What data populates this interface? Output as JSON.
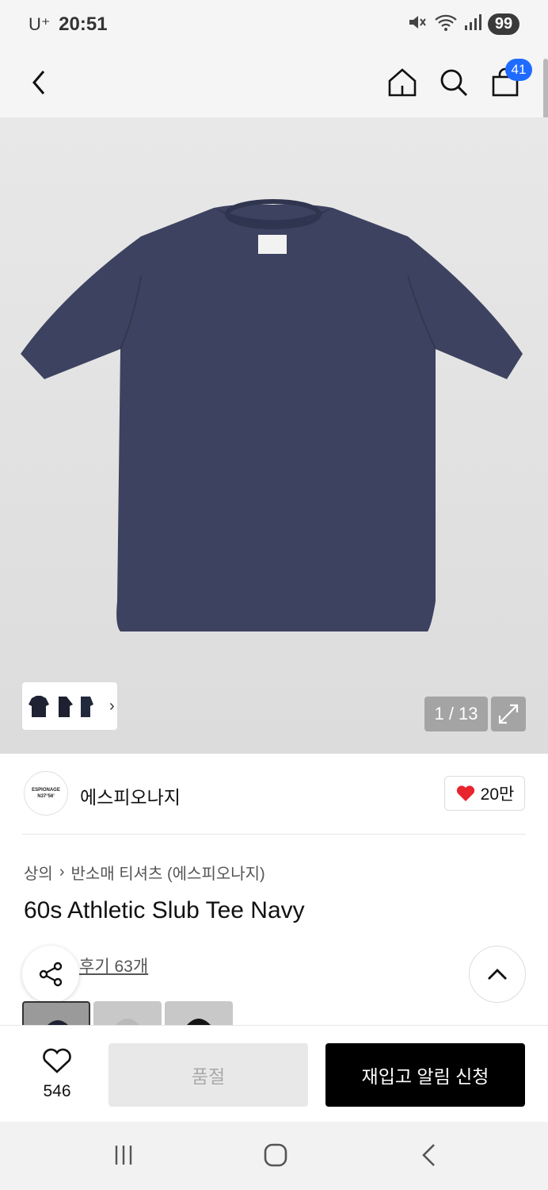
{
  "status_bar": {
    "carrier": "U⁺",
    "time": "20:51",
    "battery": "99"
  },
  "nav": {
    "cart_count": "41"
  },
  "gallery": {
    "page_counter": "1 / 13"
  },
  "brand": {
    "logo_text_1": "ESPIONAGE",
    "logo_text_2": "N37°56'",
    "name": "에스피오나지",
    "like_count": "20만"
  },
  "product": {
    "breadcrumb": [
      "상의",
      "반소매 티셔츠 (에스피오나지)"
    ],
    "title": "60s Athletic Slub Tee Navy",
    "review_link": "후기 63개"
  },
  "bottom_bar": {
    "wish_count": "546",
    "soldout_label": "품절",
    "restock_label": "재입고 알림 신청"
  },
  "colors": {
    "accent_blue": "#1f6bff",
    "heart_red": "#e8242e",
    "shirt_navy": "#3d4260"
  }
}
